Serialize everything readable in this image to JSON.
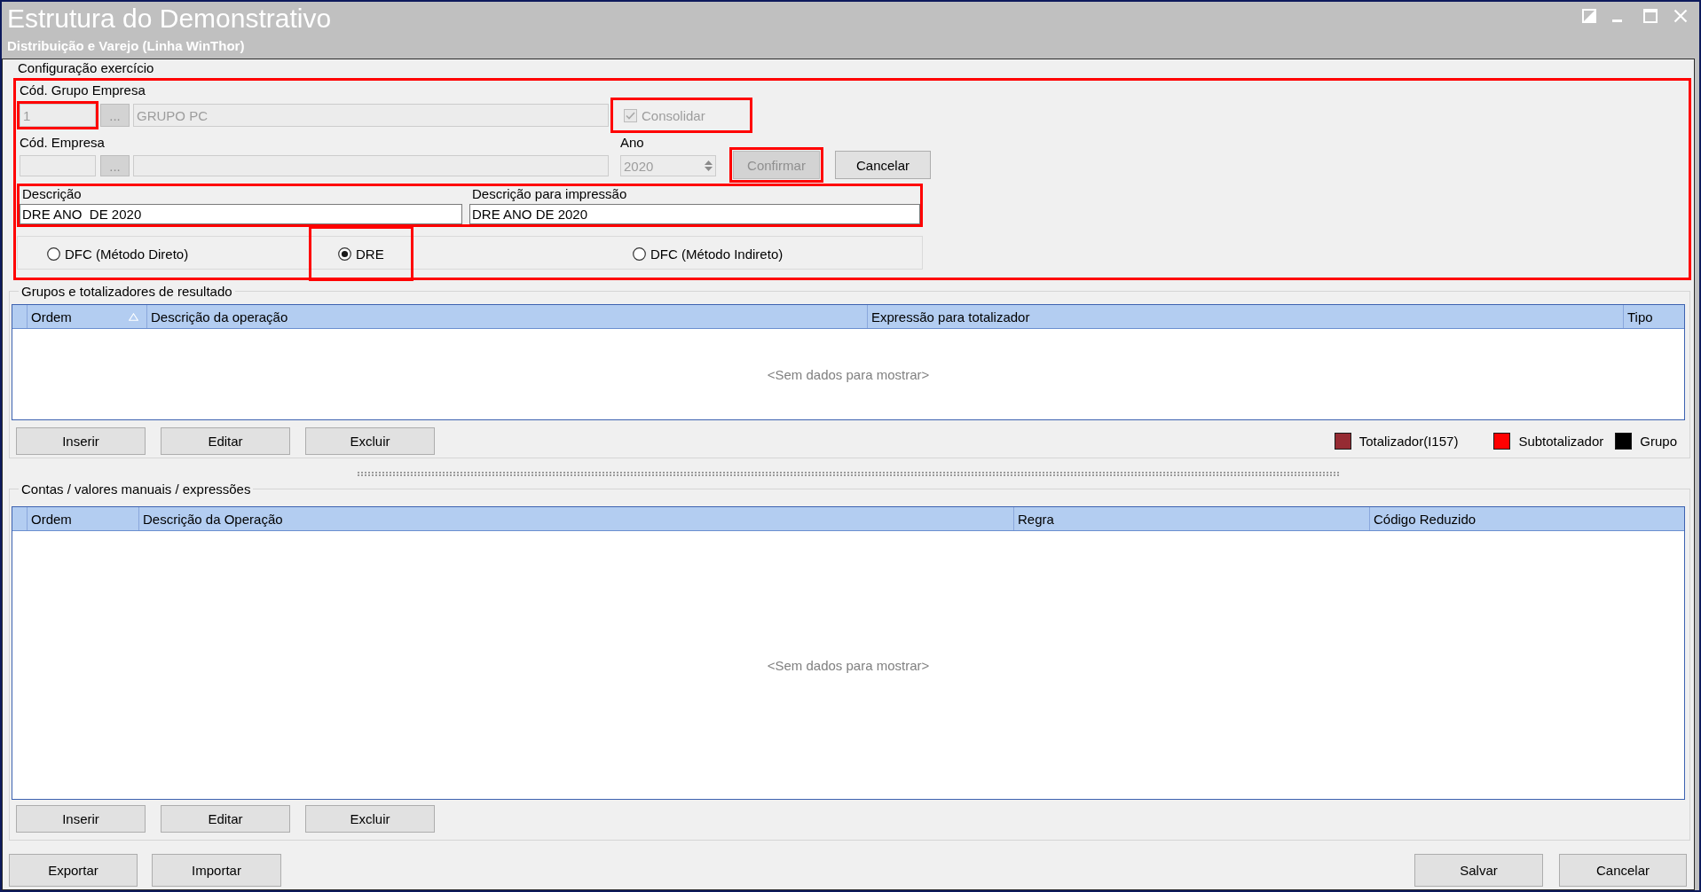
{
  "window": {
    "title": "Estrutura do Demonstrativo",
    "subtitle": "Distribuição e Varejo (Linha WinThor)"
  },
  "config": {
    "title": "Configuração exercício",
    "highlighted": true,
    "grupo_empresa": {
      "label": "Cód. Grupo Empresa",
      "code": "1",
      "lookup": "...",
      "name": "GRUPO PC",
      "disabled": true,
      "highlighted": true
    },
    "consolidar": {
      "label": "Consolidar",
      "checked": true,
      "disabled": true,
      "highlighted": true
    },
    "empresa": {
      "label": "Cód. Empresa",
      "lookup": "...",
      "disabled": true
    },
    "ano": {
      "label": "Ano",
      "value": "2020",
      "disabled": true
    },
    "buttons": [
      {
        "label": "Confirmar",
        "disabled": true,
        "highlighted": true
      },
      {
        "label": "Cancelar",
        "disabled": false,
        "highlighted": false
      }
    ],
    "descricao": {
      "highlighted": true,
      "fields": [
        {
          "label": "Descrição",
          "value": "DRE ANO  DE 2020"
        },
        {
          "label": "Descrição para impressão",
          "value": "DRE ANO DE 2020"
        }
      ]
    },
    "tipo": [
      {
        "label": "DFC (Método Direto)",
        "selected": false,
        "highlighted": false
      },
      {
        "label": "DRE",
        "selected": true,
        "highlighted": true
      },
      {
        "label": "DFC (Método Indireto)",
        "selected": false,
        "highlighted": false
      }
    ]
  },
  "grupos": {
    "title": "Grupos e totalizadores de resultado",
    "table": {
      "columns": [
        {
          "label": "Ordem",
          "sorted": true
        },
        {
          "label": "Descrição da operação",
          "sorted": false
        },
        {
          "label": "Expressão para totalizador",
          "sorted": false
        },
        {
          "label": "Tipo",
          "sorted": false
        }
      ],
      "empty_text": "<Sem dados para mostrar>"
    },
    "buttons": [
      "Inserir",
      "Editar",
      "Excluir"
    ],
    "legend": [
      {
        "label": "Totalizador(I157)",
        "color": "#962b33"
      },
      {
        "label": "Subtotalizador",
        "color": "#ff0000"
      },
      {
        "label": "Grupo",
        "color": "#000000"
      }
    ]
  },
  "contas": {
    "title": "Contas / valores manuais / expressões",
    "table": {
      "columns": [
        {
          "label": "Ordem",
          "sorted": false
        },
        {
          "label": "Descrição da Operação",
          "sorted": false
        },
        {
          "label": "Regra",
          "sorted": false
        },
        {
          "label": "Código Reduzido",
          "sorted": false
        }
      ],
      "empty_text": "<Sem dados para mostrar>"
    },
    "buttons": [
      "Inserir",
      "Editar",
      "Excluir"
    ]
  },
  "footer": {
    "left_buttons": [
      "Exportar",
      "Importar"
    ],
    "right_buttons": [
      "Salvar",
      "Cancelar"
    ]
  }
}
